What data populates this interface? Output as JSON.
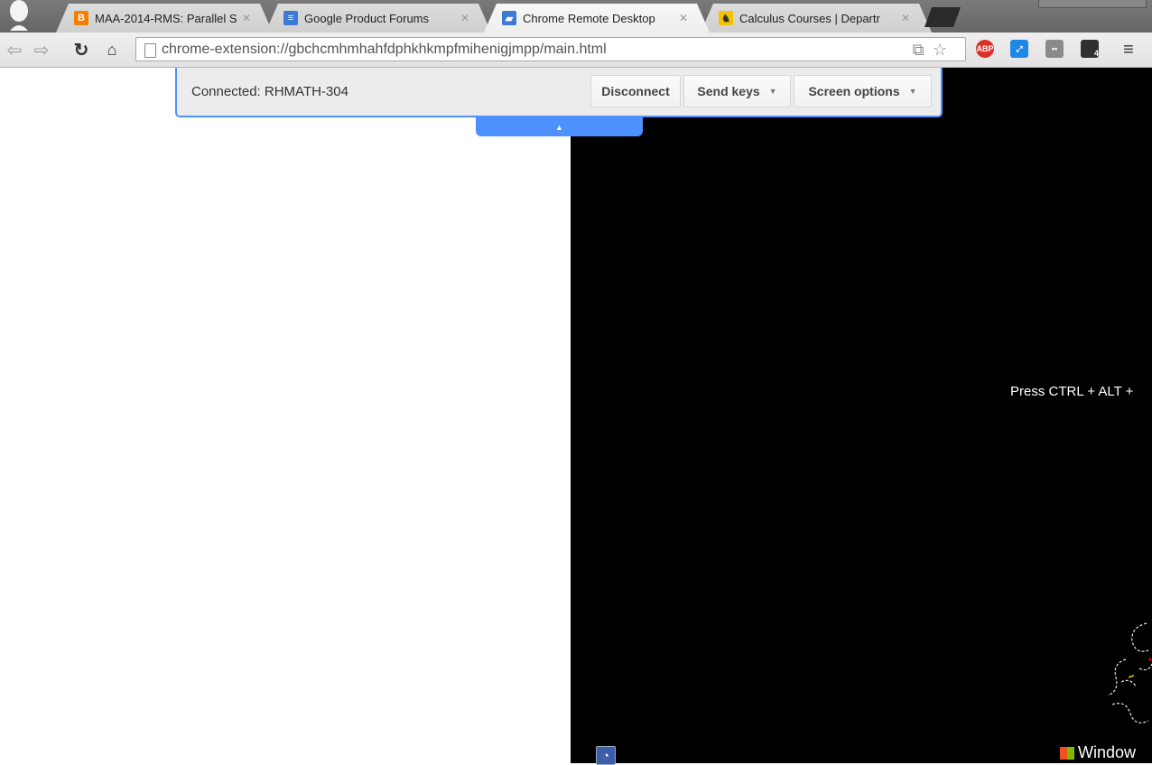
{
  "tabs": [
    {
      "title": "MAA-2014-RMS: Parallel S",
      "favicon": "blogger-icon",
      "favicon_color": "#f57d00",
      "favicon_glyph": "B",
      "active": false
    },
    {
      "title": "Google Product Forums",
      "favicon": "forums-icon",
      "favicon_color": "#3d7ad6",
      "favicon_glyph": "≡",
      "active": false
    },
    {
      "title": "Chrome Remote Desktop",
      "favicon": "remote-desktop-icon",
      "favicon_color": "#3d7ad6",
      "favicon_glyph": "▰",
      "active": true
    },
    {
      "title": "Calculus Courses | Departr",
      "favicon": "wyoming-cowboy-icon",
      "favicon_color": "#f2c300",
      "favicon_glyph": "♞",
      "active": false
    }
  ],
  "toolbar": {
    "url": "chrome-extension://gbchcmhmhahfdphkhkmpfmihenigjmpp/main.html",
    "extensions": [
      {
        "name": "adblock-plus-icon",
        "label": "ABP",
        "color": "#d9322a"
      },
      {
        "name": "expand-icon",
        "label": "⤢",
        "color": "#1e88e5"
      },
      {
        "name": "extension-gray-icon",
        "label": "••",
        "color": "#8a8a8a"
      },
      {
        "name": "grid-badge-icon",
        "label": "4",
        "color": "#303030"
      }
    ]
  },
  "remote_bar": {
    "status": "Connected:  RHMATH-304",
    "disconnect": "Disconnect",
    "send_keys": "Send keys",
    "screen_options": "Screen options"
  },
  "remote_screen": {
    "prompt": "Press CTRL + ALT +",
    "windows_text": "Window"
  },
  "colors": {
    "accent": "#4d90fe",
    "remote_background": "#000000"
  }
}
